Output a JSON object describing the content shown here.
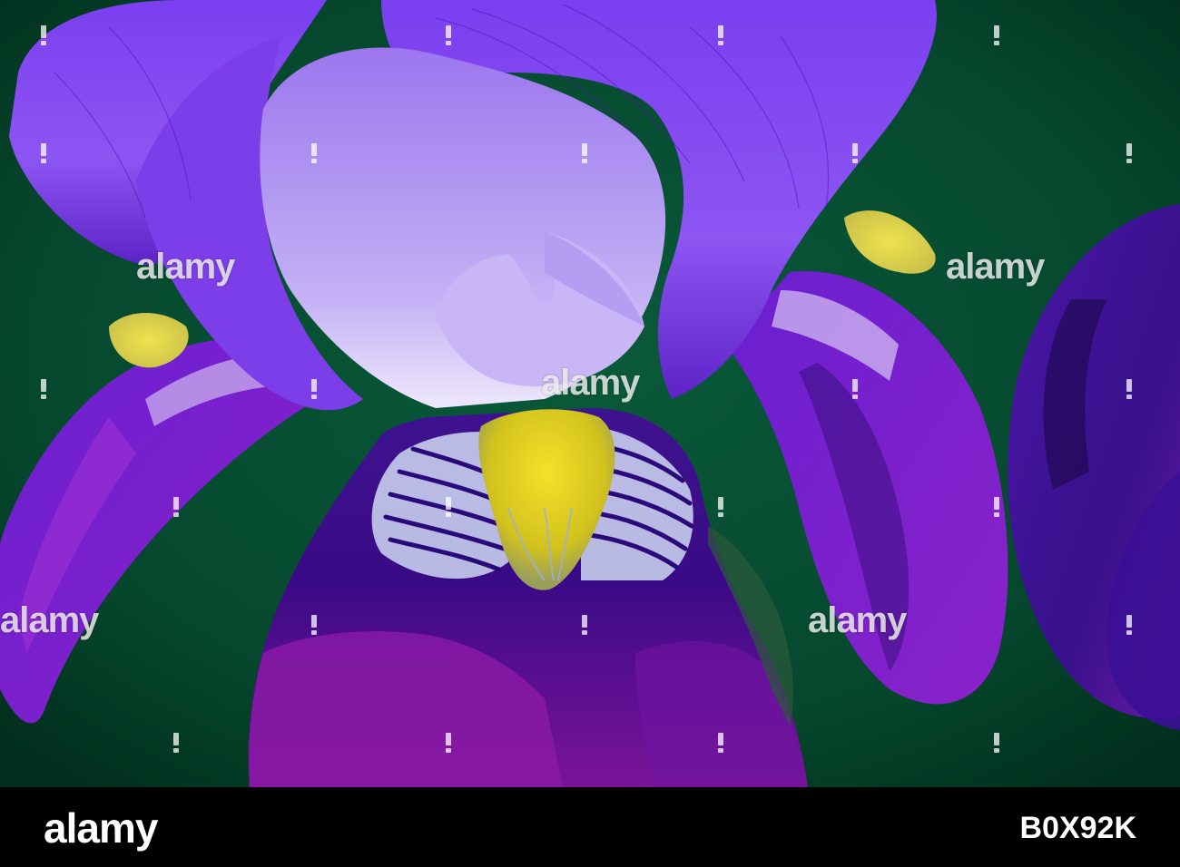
{
  "photo": {
    "subject": "purple bearded iris flower close-up",
    "colors": {
      "background": "#05472d",
      "petal_dark": "#3a0a86",
      "petal_mid": "#6b1fd0",
      "petal_light": "#a889f2",
      "petal_white": "#e7e1fb",
      "beard_yellow": "#e6d21e"
    }
  },
  "watermarks": [
    {
      "text": "alamy"
    },
    {
      "text": "alamy"
    },
    {
      "text": "alamy"
    },
    {
      "text": "alamy"
    },
    {
      "text": "alamy"
    }
  ],
  "footer": {
    "logo": "alamy",
    "image_id": "B0X92K"
  }
}
